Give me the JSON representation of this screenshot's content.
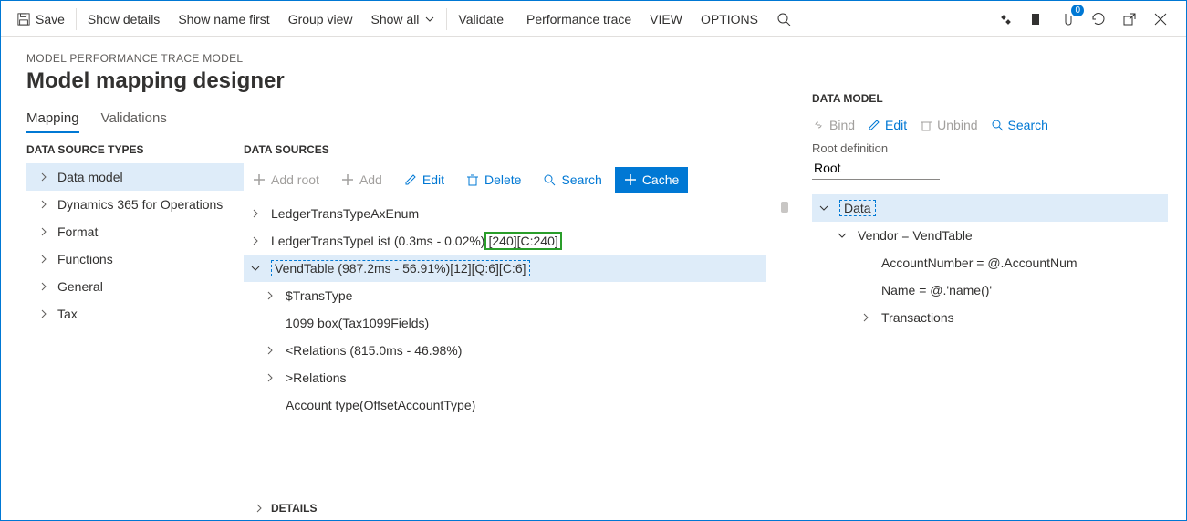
{
  "topbar": {
    "save": "Save",
    "show_details": "Show details",
    "show_name_first": "Show name first",
    "group_view": "Group view",
    "show_all": "Show all",
    "validate": "Validate",
    "performance_trace": "Performance trace",
    "view": "VIEW",
    "options": "OPTIONS",
    "badge": "0"
  },
  "breadcrumb": "MODEL PERFORMANCE TRACE MODEL",
  "page_title": "Model mapping designer",
  "tabs": {
    "mapping": "Mapping",
    "validations": "Validations"
  },
  "types_title": "DATA SOURCE TYPES",
  "types": [
    "Data model",
    "Dynamics 365 for Operations",
    "Format",
    "Functions",
    "General",
    "Tax"
  ],
  "sources_title": "DATA SOURCES",
  "src_toolbar": {
    "add_root": "Add root",
    "add": "Add",
    "edit": "Edit",
    "delete": "Delete",
    "search": "Search",
    "cache": "Cache"
  },
  "sources": {
    "r0": "LedgerTransTypeAxEnum",
    "r1a": "LedgerTransTypeList (0.3ms - 0.02%)",
    "r1b": "[240][C:240]",
    "r2": "VendTable (987.2ms - 56.91%)[12][Q:6][C:6]",
    "r3": "$TransType",
    "r4": "1099 box(Tax1099Fields)",
    "r5": "<Relations (815.0ms - 46.98%)",
    "r6": ">Relations",
    "r7": "Account type(OffsetAccountType)"
  },
  "details": "DETAILS",
  "datamodel": {
    "title": "DATA MODEL",
    "bind": "Bind",
    "edit": "Edit",
    "unbind": "Unbind",
    "search": "Search",
    "rootdef_label": "Root definition",
    "rootdef_value": "Root",
    "r0": "Data",
    "r1": "Vendor = VendTable",
    "r2": "AccountNumber = @.AccountNum",
    "r3": "Name = @.'name()'",
    "r4": "Transactions"
  }
}
